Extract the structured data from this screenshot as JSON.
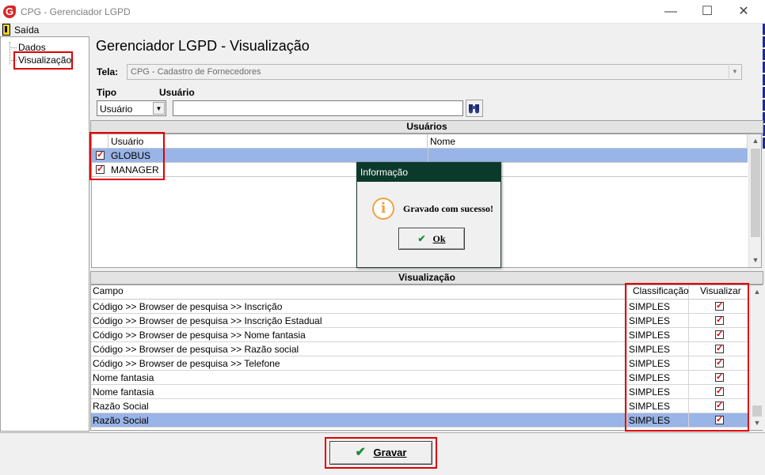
{
  "window": {
    "title": "CPG - Gerenciador LGPD",
    "logo_letter": "G",
    "minimize": "—",
    "maximize": "☐",
    "close": "✕"
  },
  "menu": {
    "exit_label": "Saída"
  },
  "tree": {
    "items": [
      {
        "label": "Dados"
      },
      {
        "label": "Visualização"
      }
    ]
  },
  "page": {
    "title": "Gerenciador LGPD - Visualização"
  },
  "form": {
    "screen_label": "Tela:",
    "screen_value": "CPG - Cadastro de Fornecedores",
    "type_label": "Tipo",
    "type_value": "Usuário",
    "user_label": "Usuário",
    "user_value": ""
  },
  "users": {
    "section_title": "Usuários",
    "columns": [
      "Usuário",
      "Nome"
    ],
    "rows": [
      {
        "checked": true,
        "user": "GLOBUS",
        "name": ""
      },
      {
        "checked": true,
        "user": "MANAGER",
        "name": ""
      }
    ]
  },
  "view": {
    "section_title": "Visualização",
    "columns": [
      "Campo",
      "Classificação",
      "Visualizar"
    ],
    "rows": [
      {
        "field": "Código >> Browser de pesquisa >> Inscrição",
        "class": "SIMPLES",
        "visible": true
      },
      {
        "field": "Código >> Browser de pesquisa >> Inscrição Estadual",
        "class": "SIMPLES",
        "visible": true
      },
      {
        "field": "Código >> Browser de pesquisa >> Nome fantasia",
        "class": "SIMPLES",
        "visible": true
      },
      {
        "field": "Código >> Browser de pesquisa >> Razão social",
        "class": "SIMPLES",
        "visible": true
      },
      {
        "field": "Código >> Browser de pesquisa >> Telefone",
        "class": "SIMPLES",
        "visible": true
      },
      {
        "field": "Nome fantasia",
        "class": "SIMPLES",
        "visible": true
      },
      {
        "field": "Nome fantasia",
        "class": "SIMPLES",
        "visible": true
      },
      {
        "field": "Razão Social",
        "class": "SIMPLES",
        "visible": true
      },
      {
        "field": "Razão Social",
        "class": "SIMPLES",
        "visible": true
      }
    ]
  },
  "dialog": {
    "title": "Informação",
    "icon": "i",
    "message": "Gravado com sucesso!",
    "ok_label": "Ok"
  },
  "actions": {
    "save_label": "Gravar"
  },
  "colors": {
    "highlight_row": "#99b4e6",
    "red_outline": "#e00000",
    "dialog_title_bg": "#0b3a2a",
    "checkmark": "#e00000",
    "accept_check": "#1f8a3a"
  }
}
